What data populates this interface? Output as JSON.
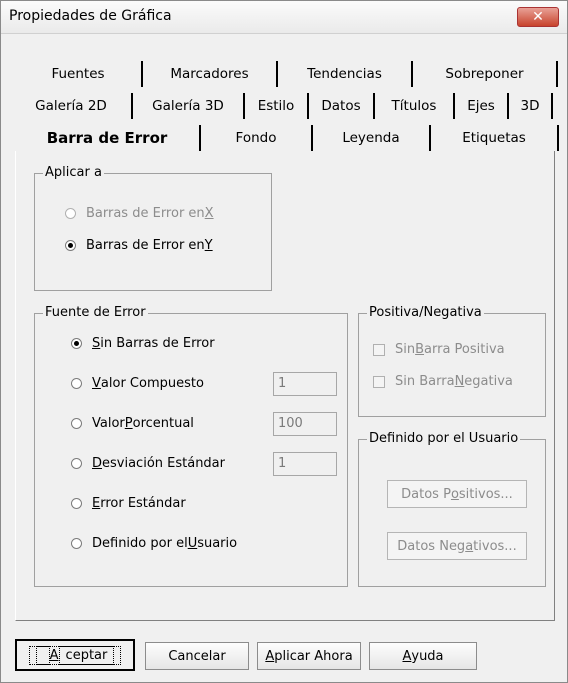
{
  "window": {
    "title": "Propiedades de Gráfica",
    "close_icon": "close-icon"
  },
  "tabs": {
    "row1": [
      "Fuentes",
      "Marcadores",
      "Tendencias",
      "Sobreponer"
    ],
    "row2": [
      "Galería 2D",
      "Galería 3D",
      "Estilo",
      "Datos",
      "Títulos",
      "Ejes",
      "3D"
    ],
    "row3": [
      "Barra de Error",
      "Fondo",
      "Leyenda",
      "Etiquetas"
    ],
    "active": "Barra de Error"
  },
  "aplicar": {
    "label": "Aplicar a",
    "opt_x": {
      "pre": "Barras de Error en ",
      "u": "X",
      "post": ""
    },
    "opt_y": {
      "pre": "Barras de Error en ",
      "u": "Y",
      "post": ""
    },
    "selected": "Y"
  },
  "fuente": {
    "label": "Fuente de Error",
    "sin": {
      "pre": "",
      "u": "S",
      "post": "in Barras de Error"
    },
    "valor_comp": {
      "pre": "",
      "u": "V",
      "post": "alor Compuesto",
      "value": "1"
    },
    "valor_porc": {
      "pre": "Valor ",
      "u": "P",
      "post": "orcentual",
      "value": "100"
    },
    "desv": {
      "pre": "",
      "u": "D",
      "post": "esviación Estándar",
      "value": "1"
    },
    "error_std": {
      "pre": "",
      "u": "E",
      "post": "rror Estándar"
    },
    "definido": {
      "pre": "Definido por el ",
      "u": "U",
      "post": "suario"
    },
    "selected": "Sin Barras de Error"
  },
  "posneg": {
    "label": "Positiva/Negativa",
    "sin_pos": {
      "pre": "Sin ",
      "u": "B",
      "post": "arra Positiva"
    },
    "sin_neg": {
      "pre": "Sin Barra ",
      "u": "N",
      "post": "egativa"
    }
  },
  "usuario": {
    "label": "Definido por el Usuario",
    "pos": {
      "pre": "Datos P",
      "u": "o",
      "post": "sitivos..."
    },
    "neg": {
      "pre": "Datos Neg",
      "u": "a",
      "post": "tivos..."
    }
  },
  "buttons": {
    "aceptar": {
      "pre": "",
      "u": "A",
      "post": "ceptar"
    },
    "cancelar": "Cancelar",
    "aplicar": {
      "pre": "",
      "u": "A",
      "post": "plicar Ahora"
    },
    "ayuda": {
      "pre": "",
      "u": "A",
      "post": "yuda"
    }
  }
}
